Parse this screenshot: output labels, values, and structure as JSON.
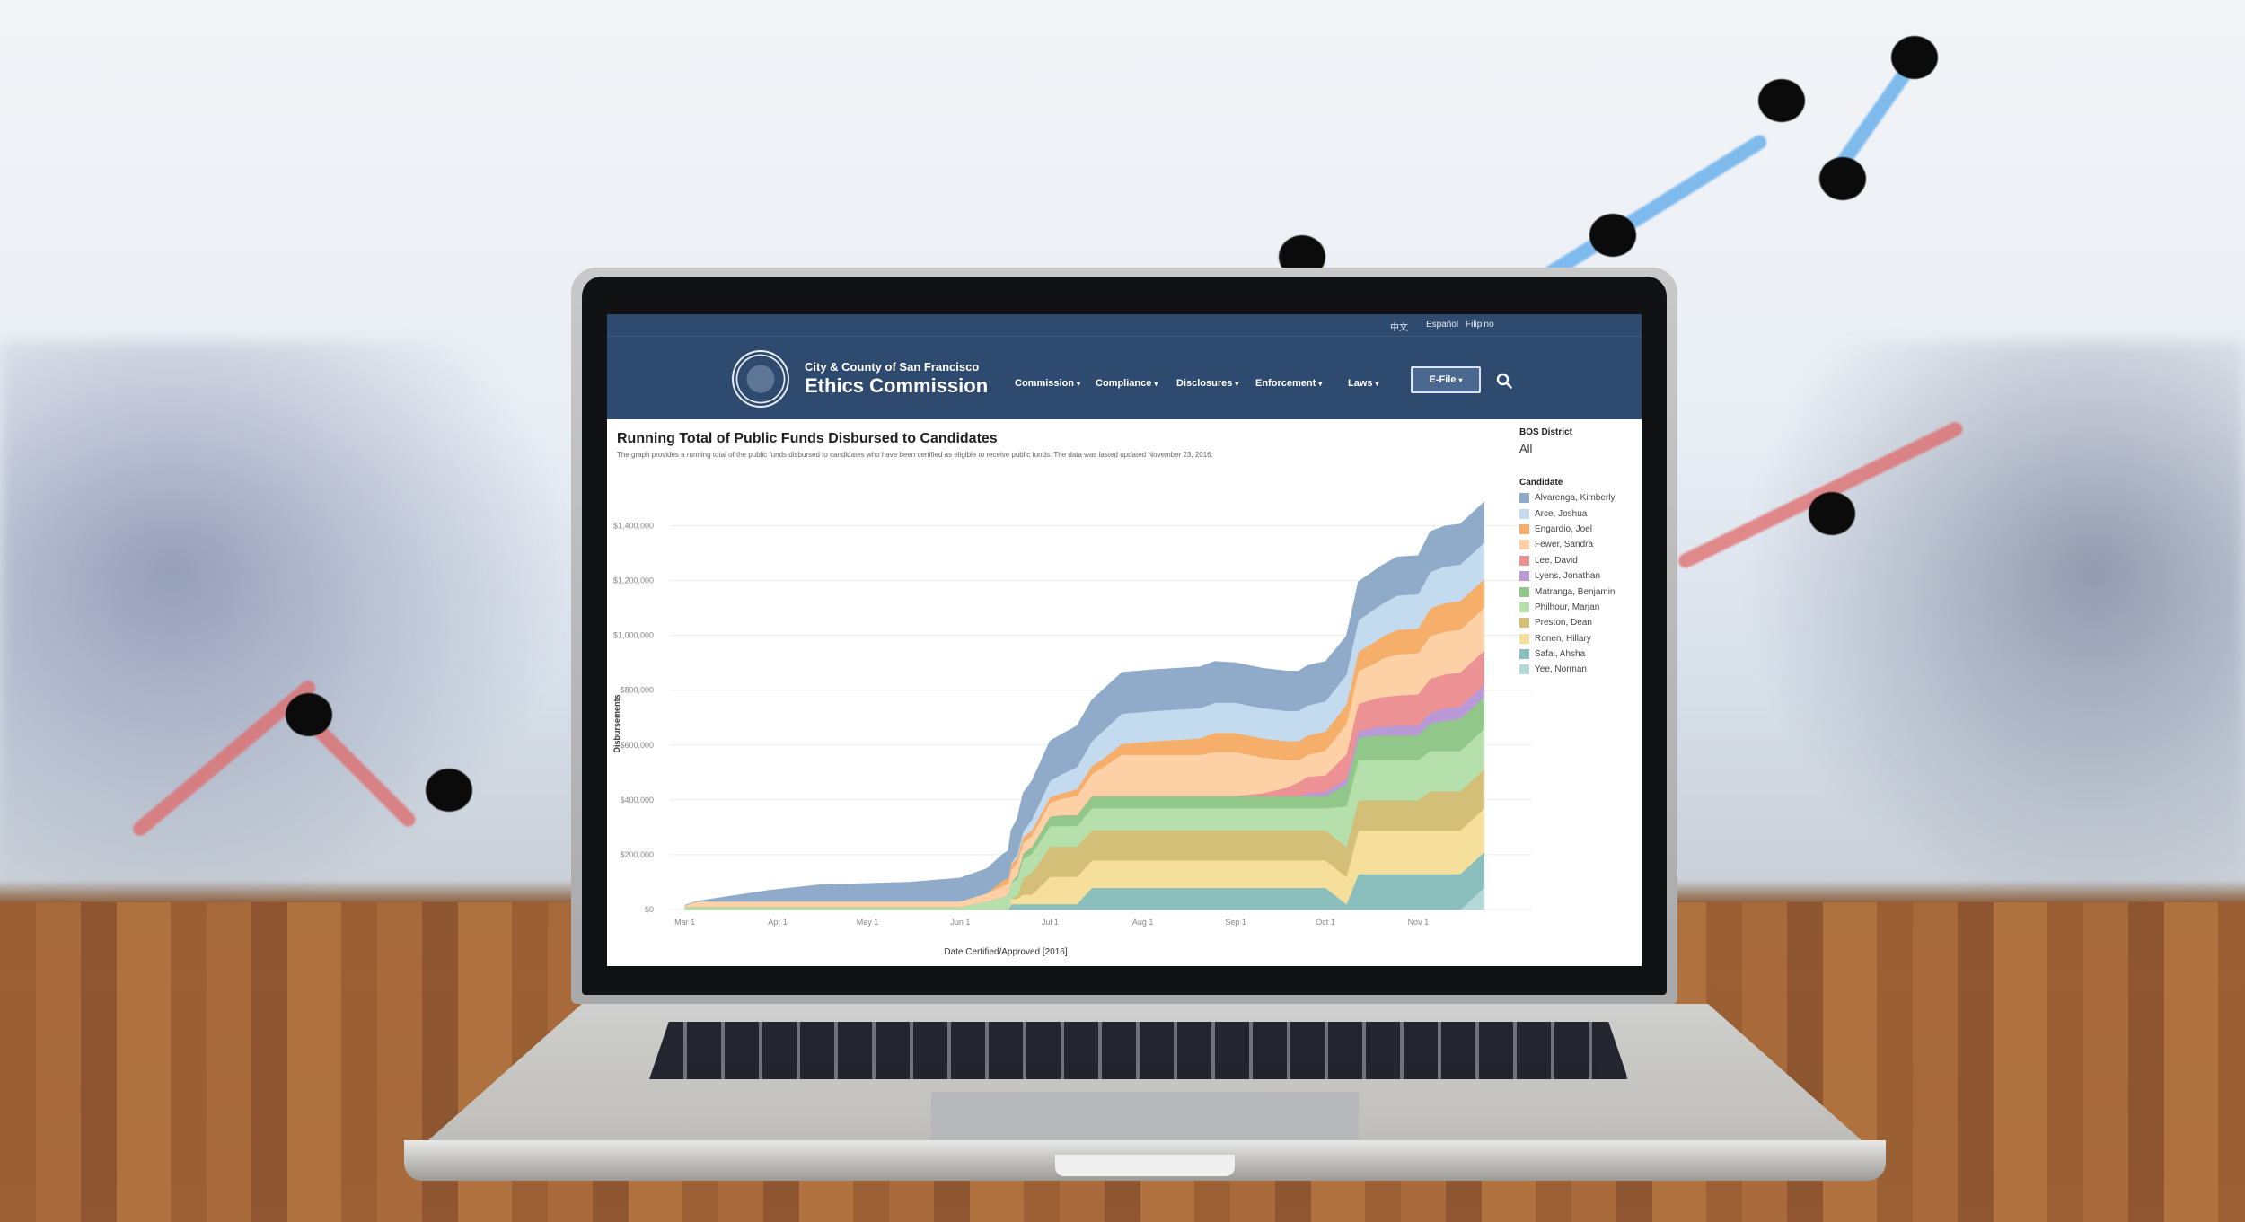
{
  "site": {
    "languages": [
      "中文",
      "Español",
      "Filipino"
    ],
    "brand_line1": "City & County of San Francisco",
    "brand_line2": "Ethics Commission",
    "nav": [
      "Commission",
      "Compliance",
      "Disclosures",
      "Enforcement",
      "Laws"
    ],
    "efile_label": "E-File",
    "caret": "▾",
    "search_icon": "search-icon",
    "colors": {
      "header": "#2e4a6f",
      "efile_bg": "#4b6890"
    }
  },
  "filters": {
    "district_label": "BOS District",
    "district_value": "All",
    "candidate_label": "Candidate"
  },
  "chart_data": {
    "type": "area",
    "stacked": true,
    "title": "Running Total of Public Funds Disbursed to Candidates",
    "subtitle": "The graph provides a running total of the public funds disbursed to candidates who have been certified as eligible to receive public funds. The data was lasted updated November 23, 2016.",
    "xlabel": "Date Certified/Approved [2016]",
    "ylabel": "Disbursements",
    "ylim": [
      0,
      1500000
    ],
    "yticks": [
      0,
      200000,
      400000,
      600000,
      800000,
      1000000,
      1200000,
      1400000
    ],
    "ytick_labels": [
      "$0",
      "$200,000",
      "$400,000",
      "$600,000",
      "$800,000",
      "$1,000,000",
      "$1,200,000",
      "$1,400,000"
    ],
    "xticks": [
      "2016-03-01",
      "2016-04-01",
      "2016-05-01",
      "2016-06-01",
      "2016-07-01",
      "2016-08-01",
      "2016-09-01",
      "2016-10-01",
      "2016-11-01"
    ],
    "xtick_labels": [
      "Mar 1",
      "Apr 1",
      "May 1",
      "Jun 1",
      "Jul 1",
      "Aug 1",
      "Sep 1",
      "Oct 1",
      "Nov 1"
    ],
    "xlim": [
      "2016-02-25",
      "2016-11-30"
    ],
    "grid": true,
    "legend_position": "right",
    "dates": [
      "2016-03-01",
      "2016-03-05",
      "2016-03-29",
      "2016-04-15",
      "2016-05-15",
      "2016-06-01",
      "2016-06-10",
      "2016-06-15",
      "2016-06-17",
      "2016-06-18",
      "2016-06-20",
      "2016-06-22",
      "2016-06-25",
      "2016-07-01",
      "2016-07-05",
      "2016-07-10",
      "2016-07-15",
      "2016-07-18",
      "2016-07-25",
      "2016-08-05",
      "2016-08-20",
      "2016-08-25",
      "2016-09-01",
      "2016-09-10",
      "2016-09-18",
      "2016-09-22",
      "2016-09-25",
      "2016-10-01",
      "2016-10-08",
      "2016-10-12",
      "2016-10-18",
      "2016-10-20",
      "2016-10-25",
      "2016-11-01",
      "2016-11-05",
      "2016-11-10",
      "2016-11-15",
      "2016-11-23"
    ],
    "series": [
      {
        "name": "Yee, Norman",
        "color": "#b3d8d6",
        "values": [
          0,
          0,
          0,
          0,
          0,
          0,
          0,
          0,
          0,
          0,
          0,
          0,
          0,
          0,
          0,
          0,
          0,
          0,
          0,
          0,
          0,
          0,
          0,
          0,
          0,
          0,
          0,
          0,
          0,
          0,
          0,
          0,
          0,
          0,
          0,
          0,
          0,
          80000,
          80000
        ]
      },
      {
        "name": "Safai, Ahsha",
        "color": "#8bbfbd",
        "values": [
          0,
          0,
          0,
          0,
          0,
          0,
          0,
          0,
          0,
          20000,
          20000,
          20000,
          20000,
          20000,
          20000,
          20000,
          80000,
          80000,
          80000,
          80000,
          80000,
          80000,
          80000,
          80000,
          80000,
          80000,
          80000,
          80000,
          20000,
          130000,
          130000,
          130000,
          130000,
          130000,
          130000,
          130000,
          130000,
          130000,
          130000
        ]
      },
      {
        "name": "Ronen, Hillary",
        "color": "#f6df9b",
        "values": [
          0,
          0,
          0,
          0,
          0,
          0,
          0,
          0,
          0,
          20000,
          20000,
          35000,
          35000,
          100000,
          100000,
          100000,
          100000,
          100000,
          100000,
          100000,
          100000,
          100000,
          100000,
          100000,
          100000,
          100000,
          100000,
          100000,
          100000,
          159000,
          159000,
          159000,
          159000,
          159000,
          159000,
          159000,
          159000,
          159000,
          159000
        ]
      },
      {
        "name": "Preston, Dean",
        "color": "#d4bf78",
        "values": [
          0,
          0,
          0,
          0,
          0,
          0,
          0,
          0,
          0,
          0,
          10000,
          60000,
          80000,
          110000,
          110000,
          110000,
          110000,
          110000,
          110000,
          110000,
          110000,
          110000,
          110000,
          110000,
          110000,
          110000,
          110000,
          110000,
          110000,
          110000,
          110000,
          110000,
          110000,
          110000,
          143000,
          143000,
          143000,
          143000,
          143000
        ]
      },
      {
        "name": "Philhour, Marjan",
        "color": "#b5e0ac",
        "values": [
          10000,
          10000,
          10000,
          10000,
          10000,
          10000,
          30000,
          45000,
          55000,
          60000,
          60000,
          70000,
          70000,
          75000,
          75000,
          75000,
          80000,
          80000,
          80000,
          80000,
          80000,
          80000,
          80000,
          80000,
          80000,
          80000,
          80000,
          80000,
          147000,
          147000,
          147000,
          147000,
          147000,
          147000,
          147000,
          147000,
          147000,
          147000,
          147000
        ]
      },
      {
        "name": "Matranga, Benjamin",
        "color": "#92c78a",
        "values": [
          0,
          0,
          0,
          0,
          0,
          0,
          0,
          0,
          0,
          0,
          15000,
          20000,
          25000,
          35000,
          40000,
          40000,
          45000,
          45000,
          45000,
          45000,
          45000,
          45000,
          45000,
          45000,
          45000,
          45000,
          45000,
          45000,
          80000,
          80000,
          90000,
          90000,
          90000,
          90000,
          100000,
          110000,
          117000,
          117000,
          117000
        ]
      },
      {
        "name": "Lyens, Jonathan",
        "color": "#b99ad6",
        "values": [
          0,
          0,
          0,
          0,
          0,
          0,
          0,
          0,
          0,
          0,
          0,
          0,
          0,
          0,
          0,
          0,
          0,
          0,
          0,
          0,
          0,
          0,
          0,
          0,
          0,
          0,
          10000,
          15000,
          20000,
          25000,
          30000,
          30000,
          35000,
          35000,
          40000,
          45000,
          45000,
          45000,
          45000
        ]
      },
      {
        "name": "Lee, David",
        "color": "#ec9194",
        "values": [
          0,
          0,
          0,
          0,
          0,
          0,
          0,
          0,
          0,
          0,
          0,
          0,
          0,
          0,
          0,
          0,
          0,
          0,
          0,
          0,
          0,
          0,
          0,
          10000,
          30000,
          50000,
          60000,
          60000,
          90000,
          100000,
          105000,
          110000,
          110000,
          115000,
          124000,
          124000,
          124000,
          124000,
          124000
        ]
      },
      {
        "name": "Fewer, Sandra",
        "color": "#fdd0a6",
        "values": [
          5000,
          20000,
          20000,
          20000,
          20000,
          20000,
          30000,
          40000,
          40000,
          45000,
          45000,
          40000,
          40000,
          50000,
          60000,
          70000,
          80000,
          100000,
          150000,
          150000,
          150000,
          160000,
          160000,
          130000,
          100000,
          80000,
          80000,
          90000,
          110000,
          120000,
          130000,
          140000,
          150000,
          150000,
          156000,
          156000,
          156000,
          156000,
          156000
        ]
      },
      {
        "name": "Engardio, Joel",
        "color": "#f6ae6b",
        "values": [
          0,
          0,
          0,
          0,
          0,
          0,
          0,
          20000,
          20000,
          20000,
          20000,
          20000,
          20000,
          20000,
          20000,
          25000,
          30000,
          30000,
          40000,
          50000,
          60000,
          70000,
          70000,
          70000,
          70000,
          70000,
          70000,
          70000,
          70000,
          70000,
          80000,
          80000,
          90000,
          90000,
          100000,
          105000,
          105000,
          105000,
          105000
        ]
      },
      {
        "name": "Arce, Joshua",
        "color": "#c4dbef",
        "values": [
          0,
          0,
          0,
          0,
          0,
          0,
          0,
          0,
          0,
          5000,
          10000,
          20000,
          40000,
          60000,
          70000,
          80000,
          90000,
          100000,
          110000,
          110000,
          110000,
          110000,
          110000,
          110000,
          110000,
          110000,
          110000,
          110000,
          110000,
          115000,
          120000,
          120000,
          125000,
          125000,
          133000,
          133000,
          133000,
          133000,
          133000
        ]
      },
      {
        "name": "Alvarenga, Kimberly",
        "color": "#8fabc9",
        "values": [
          0,
          0,
          40000,
          60000,
          70000,
          85000,
          90000,
          95000,
          100000,
          120000,
          130000,
          140000,
          140000,
          145000,
          145000,
          150000,
          150000,
          150000,
          150000,
          150000,
          150000,
          150000,
          145000,
          145000,
          145000,
          145000,
          145000,
          145000,
          140000,
          140000,
          140000,
          140000,
          140000,
          140000,
          147000,
          147000,
          147000,
          147000,
          147000
        ]
      }
    ]
  }
}
